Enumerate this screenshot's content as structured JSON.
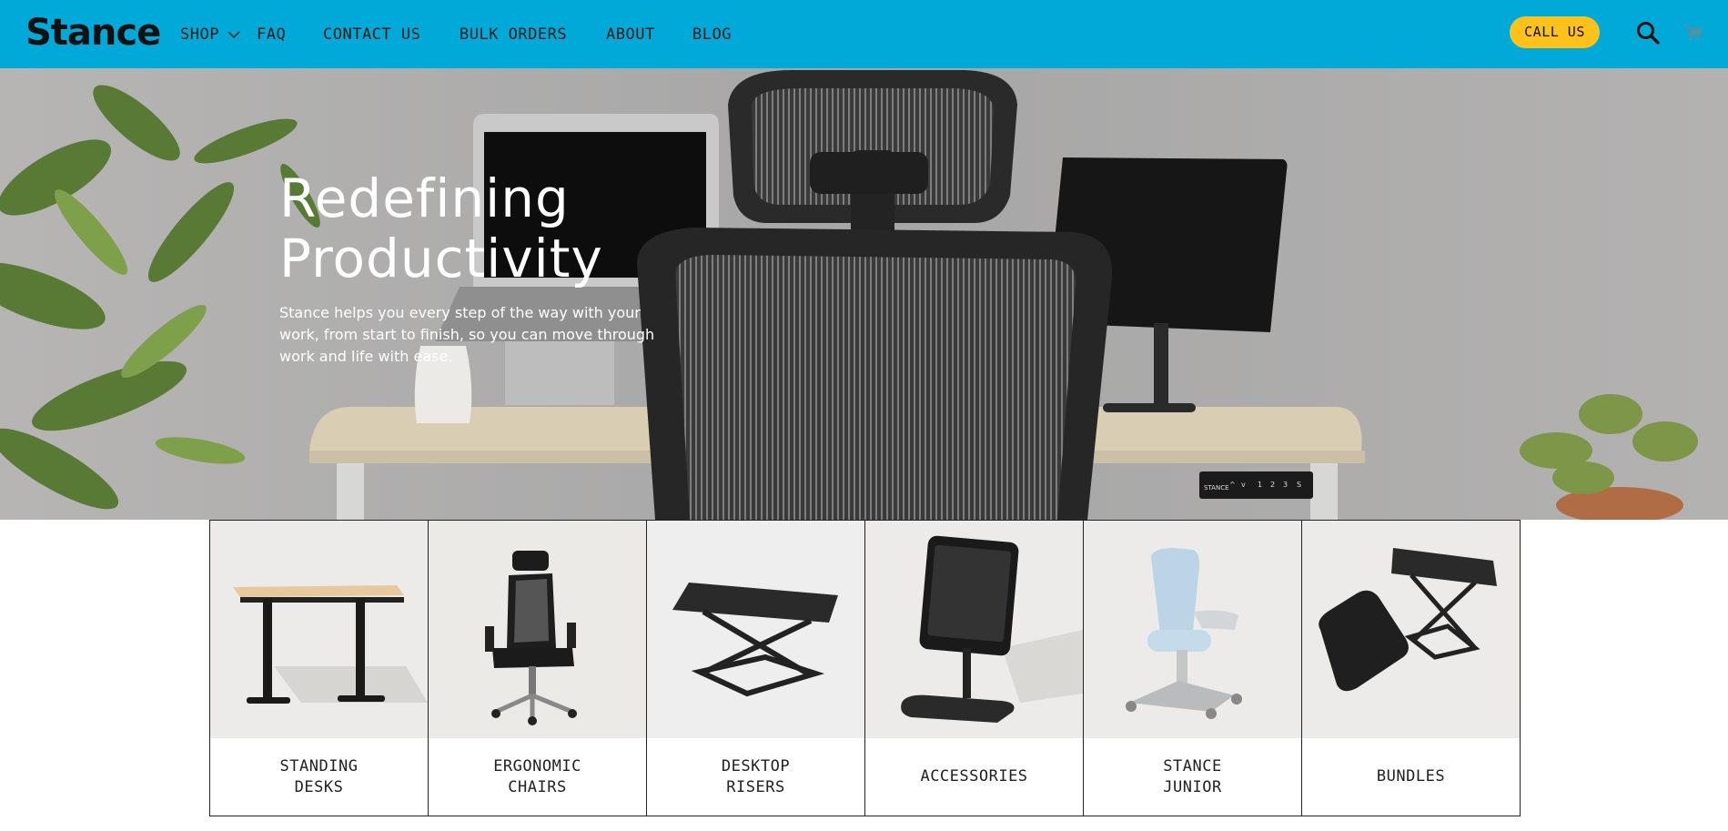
{
  "header": {
    "logo": "Stance",
    "nav": [
      {
        "label": "SHOP"
      },
      {
        "label": "FAQ"
      },
      {
        "label": "CONTACT US"
      },
      {
        "label": "BULK ORDERS"
      },
      {
        "label": "ABOUT"
      },
      {
        "label": "BLOG"
      }
    ],
    "call_label": "CALL US",
    "brand_color": "#00a9d7",
    "call_button_color": "#ffc21a",
    "icons": [
      "chevron-down-icon",
      "search-icon",
      "cart-icon"
    ]
  },
  "hero": {
    "title_line1": "Redefining",
    "title_line2": "Productivity",
    "text": "Stance helps you every step of the way with your work, from start to finish, so you can move through work and life with ease.",
    "controller_label": "STANCE",
    "controller_buttons": [
      "^",
      "v",
      "1",
      "2",
      "3",
      "S"
    ]
  },
  "categories": [
    {
      "label": "STANDING\nDESKS"
    },
    {
      "label": "ERGONOMIC\nCHAIRS"
    },
    {
      "label": "DESKTOP\nRISERS"
    },
    {
      "label": "ACCESSORIES"
    },
    {
      "label": "STANCE\nJUNIOR"
    },
    {
      "label": "BUNDLES"
    }
  ]
}
